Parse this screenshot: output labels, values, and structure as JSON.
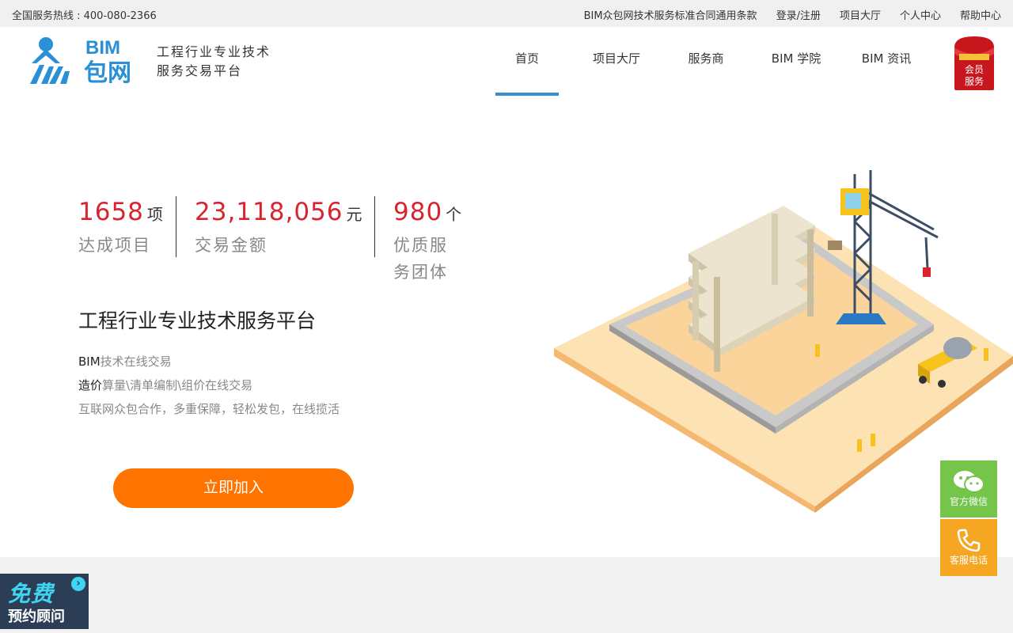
{
  "topbar": {
    "hotline": "全国服务热线 : 400-080-2366",
    "links": [
      "BIM众包网技术服务标准合同通用条款",
      "登录/注册",
      "项目大厅",
      "个人中心",
      "帮助中心"
    ]
  },
  "header": {
    "logo_text_top": "BIM",
    "logo_text_main": "包网",
    "slogan_line1": "工程行业专业技术",
    "slogan_line2": "服务交易平台",
    "nav": [
      "首页",
      "项目大厅",
      "服务商",
      "BIM 学院",
      "BIM 资讯"
    ],
    "active_nav": "首页",
    "vip_line1": "会员",
    "vip_line2": "服务"
  },
  "stats": [
    {
      "value": "1658",
      "unit": "项",
      "label": "达成项目"
    },
    {
      "value": "23,118,056",
      "unit": "元",
      "label": "交易金额"
    },
    {
      "value": "980",
      "unit": "个",
      "label": "优质服务团体"
    }
  ],
  "hero": {
    "title": "工程行业专业技术服务平台",
    "line1_strong": "BIM",
    "line1_rest": "技术在线交易",
    "line2_strong": "造价",
    "line2_rest": "算量\\清单编制\\组价在线交易",
    "line3": "互联网众包合作，多重保障，轻松发包，在线揽活",
    "join_button": "立即加入"
  },
  "side": {
    "wechat_label": "官方微信",
    "phone_label": "客服电话"
  },
  "consult": {
    "big": "免费",
    "small": "预约顾问"
  },
  "colors": {
    "accent_blue": "#3a8fd0",
    "stat_red": "#d9242f",
    "join_orange": "#ff7300",
    "wechat_green": "#74c54a",
    "phone_orange": "#f5a623"
  }
}
